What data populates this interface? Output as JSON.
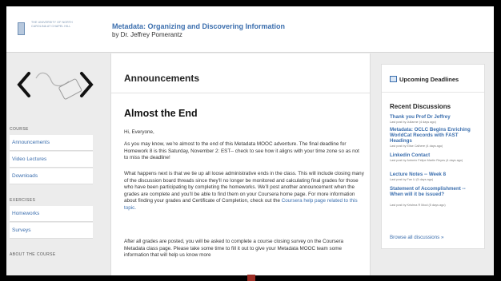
{
  "header": {
    "logo_text": "The University of North Carolina at Chapel Hill",
    "course_title": "Metadata: Organizing and Discovering Information",
    "instructor": "by Dr. Jeffrey Pomerantz"
  },
  "sidebar": {
    "course_heading": "COURSE",
    "course_items": [
      "Announcements",
      "Video Lectures",
      "Downloads"
    ],
    "exercises_heading": "EXERCISES",
    "exercises_items": [
      "Homeworks",
      "Surveys"
    ],
    "about_heading": "ABOUT THE COURSE"
  },
  "content": {
    "section_title": "Announcements",
    "post_title": "Almost the End",
    "greeting": "Hi, Everyone,",
    "p1": "As you may know, we’re almost to the end of this Metadata MOOC adventure. The final deadline for Homework 8 is this Saturday, November 2: EST-- check to see how it aligns with your time zone so as not to miss the deadline!",
    "p2_start": "What happens next is that we tie up all loose administrative ends in the class. This will include closing many of the discussion board threads since they’ll no longer be monitored and calculating final grades for those who have been participating by completing the homeworks. We’ll post another announcement when the grades are complete and you’ll be able to find them on your Coursera home page. For more information about finding your grades and Certificate of Completion, check out the ",
    "p2_link": "Coursera help page related to this topic.",
    "p3": "After all grades are posted, you will be asked to complete a course closing survey on the Coursera Metadata class page. Please take some time to fill it out to give your Metadata MOOC team some information that will help us know more"
  },
  "rightbar": {
    "deadlines_title": "Upcoming Deadlines",
    "recent_title": "Recent Discussions",
    "discussions": [
      {
        "title": "Thank you Prof Dr Jeffrey",
        "meta": "Last post by Julianne (4 days ago)"
      },
      {
        "title": "Metadata: OCLC Begins Enriching WorldCat Records with FAST Headings",
        "meta": "Last post by Elise Calhere (4 days ago)"
      },
      {
        "title": "Linkedin Contact",
        "meta": "Last post by Antonio Felipe Martin Reyes (4 days ago)"
      },
      {
        "title": "Lecture Notes -- Week 8",
        "meta": "Last post by Fan Li (5 days ago)"
      },
      {
        "title": "Statement of Accomplishment -- When will it be issued?",
        "meta": "Last post by Krishna R Mool (5 days ago)"
      }
    ],
    "browse_all": "Browse all discussions »"
  }
}
